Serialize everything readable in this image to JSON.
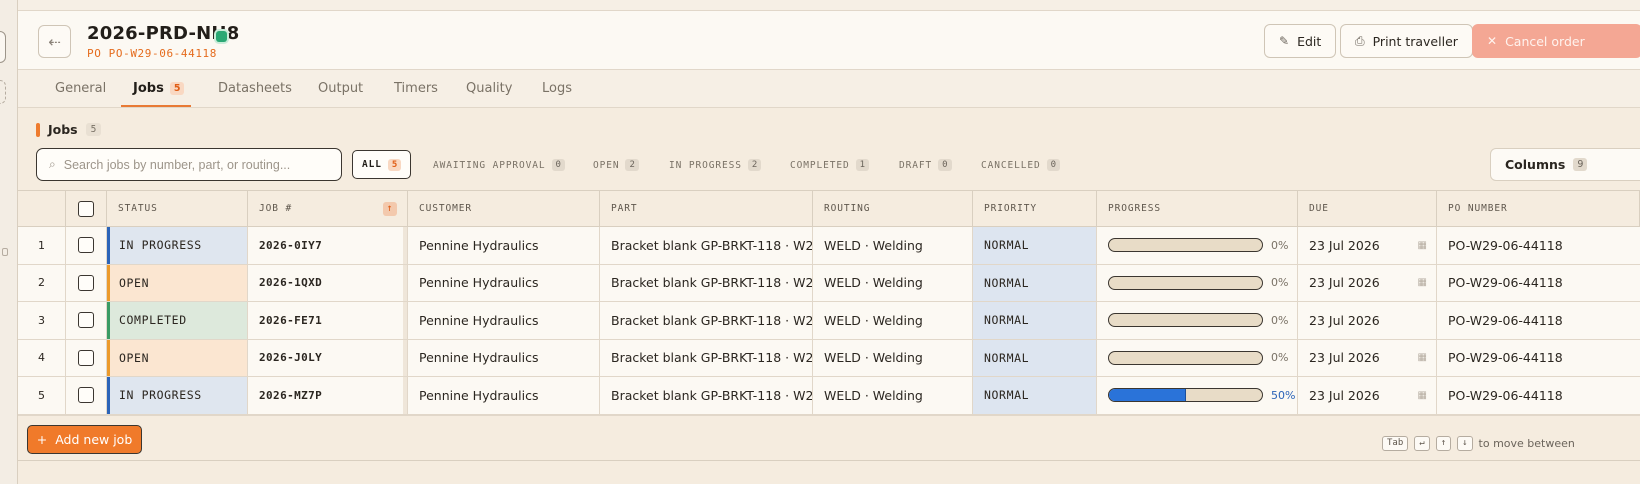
{
  "order": {
    "title": "2026-PRD-NH8",
    "po_label": "PO PO-W29-06-44118"
  },
  "header_actions": {
    "edit": "Edit",
    "print": "Print traveller",
    "cancel": "Cancel order"
  },
  "tabs": [
    {
      "label": "General"
    },
    {
      "label": "Jobs",
      "badge": "5"
    },
    {
      "label": "Datasheets"
    },
    {
      "label": "Output"
    },
    {
      "label": "Timers"
    },
    {
      "label": "Quality"
    },
    {
      "label": "Logs"
    }
  ],
  "jobs_section": {
    "title": "Jobs",
    "count": "5",
    "search_placeholder": "Search jobs by number, part, or routing...",
    "filters": [
      {
        "label": "ALL",
        "count": "5"
      },
      {
        "label": "AWAITING APPROVAL",
        "count": "0"
      },
      {
        "label": "OPEN",
        "count": "2"
      },
      {
        "label": "IN PROGRESS",
        "count": "2"
      },
      {
        "label": "COMPLETED",
        "count": "1"
      },
      {
        "label": "DRAFT",
        "count": "0"
      },
      {
        "label": "CANCELLED",
        "count": "0"
      }
    ],
    "columns_button": "Columns",
    "columns_count": "9"
  },
  "table": {
    "headers": {
      "status": "STATUS",
      "job": "JOB #",
      "customer": "CUSTOMER",
      "part": "PART",
      "routing": "ROUTING",
      "priority": "PRIORITY",
      "progress": "PROGRESS",
      "due": "DUE",
      "po": "PO NUMBER"
    },
    "rows": [
      {
        "idx": "1",
        "status": "IN PROGRESS",
        "job": "2026-0IY7",
        "customer": "Pennine Hydraulics",
        "part": "Bracket blank GP-BRKT-118 · W2...",
        "routing": "WELD · Welding",
        "priority": "NORMAL",
        "progress": 0,
        "progress_label": "0%",
        "due": "23 Jul 2026",
        "po": "PO-W29-06-44118"
      },
      {
        "idx": "2",
        "status": "OPEN",
        "job": "2026-1QXD",
        "customer": "Pennine Hydraulics",
        "part": "Bracket blank GP-BRKT-118 · W2...",
        "routing": "WELD · Welding",
        "priority": "NORMAL",
        "progress": 0,
        "progress_label": "0%",
        "due": "23 Jul 2026",
        "po": "PO-W29-06-44118"
      },
      {
        "idx": "3",
        "status": "COMPLETED",
        "job": "2026-FE71",
        "customer": "Pennine Hydraulics",
        "part": "Bracket blank GP-BRKT-118 · W2...",
        "routing": "WELD · Welding",
        "priority": "NORMAL",
        "progress": 0,
        "progress_label": "0%",
        "due": "23 Jul 2026",
        "po": "PO-W29-06-44118"
      },
      {
        "idx": "4",
        "status": "OPEN",
        "job": "2026-J0LY",
        "customer": "Pennine Hydraulics",
        "part": "Bracket blank GP-BRKT-118 · W2...",
        "routing": "WELD · Welding",
        "priority": "NORMAL",
        "progress": 0,
        "progress_label": "0%",
        "due": "23 Jul 2026",
        "po": "PO-W29-06-44118"
      },
      {
        "idx": "5",
        "status": "IN PROGRESS",
        "job": "2026-MZ7P",
        "customer": "Pennine Hydraulics",
        "part": "Bracket blank GP-BRKT-118 · W2...",
        "routing": "WELD · Welding",
        "priority": "NORMAL",
        "progress": 50,
        "progress_label": "50%",
        "due": "23 Jul 2026",
        "po": "PO-W29-06-44118"
      }
    ]
  },
  "footer": {
    "add_job": "Add new job",
    "keys": [
      "Tab",
      "↵",
      "↑",
      "↓"
    ],
    "hint": "to move between"
  },
  "colors": {
    "accent": "#f07a2a",
    "status_in_progress": "#2c64b8",
    "status_open": "#ec9a2a",
    "status_completed": "#3a9b64"
  }
}
